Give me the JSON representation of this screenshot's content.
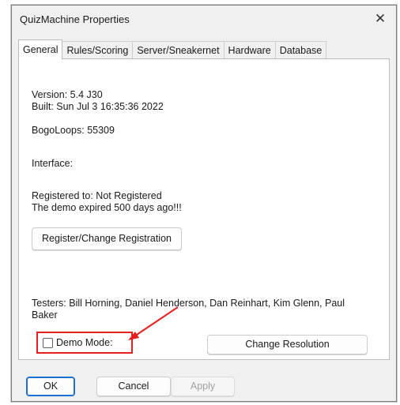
{
  "window": {
    "title": "QuizMachine Properties"
  },
  "tabs": [
    "General",
    "Rules/Scoring",
    "Server/Sneakernet",
    "Hardware",
    "Database"
  ],
  "general": {
    "version": "Version: 5.4 J30",
    "built": "Built: Sun Jul  3 16:35:36 2022",
    "bogoloops": "BogoLoops: 55309",
    "interface": "Interface:",
    "registered_to": "Registered to: Not Registered",
    "demo_expired": "The demo expired 500 days ago!!!",
    "register_button": "Register/Change Registration",
    "testers_line1": "Testers: Bill Horning, Daniel Henderson, Dan Reinhart, Kim Glenn, Paul",
    "testers_line2": "Baker",
    "demo_mode_label": "Demo Mode:",
    "demo_mode_checked": false,
    "change_resolution_button": "Change Resolution"
  },
  "footer": {
    "ok": "OK",
    "cancel": "Cancel",
    "apply": "Apply"
  },
  "annotation": {
    "highlight_color": "#e81f1f"
  }
}
